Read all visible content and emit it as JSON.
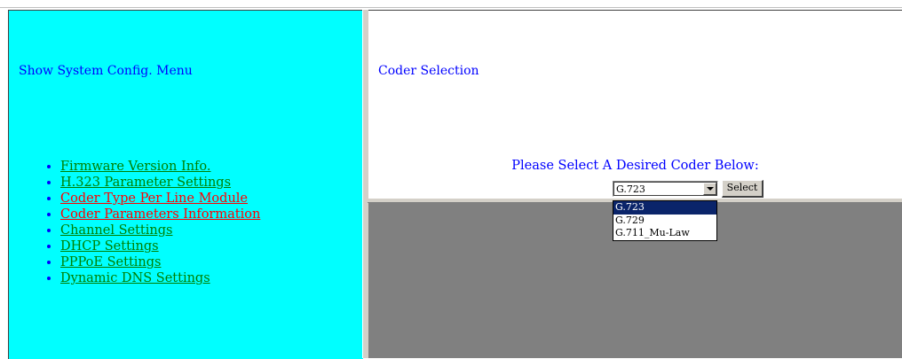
{
  "left_menu": {
    "title": "Show System Config. Menu",
    "items": [
      {
        "label": "Firmware Version Info.",
        "color": "#008000"
      },
      {
        "label": "H.323 Parameter Settings",
        "color": "#008000"
      },
      {
        "label": "Coder Type Per Line Module",
        "color": "#ff0000"
      },
      {
        "label": "Coder Parameters Information",
        "color": "#ff0000"
      },
      {
        "label": "Channel Settings",
        "color": "#008000"
      },
      {
        "label": "DHCP Settings",
        "color": "#008000"
      },
      {
        "label": "PPPoE Settings",
        "color": "#008000"
      },
      {
        "label": "Dynamic DNS Settings",
        "color": "#008000"
      }
    ]
  },
  "main": {
    "title": "Coder Selection",
    "prompt": "Please Select A Desired Coder Below:",
    "coder_select": {
      "value": "G.723",
      "options": [
        "G.723",
        "G.729",
        "G.711_Mu-Law"
      ],
      "highlighted": "G.723"
    },
    "select_button_label": "Select"
  },
  "colors": {
    "menu_background": "#00ffff",
    "text_blue": "#0000ff",
    "link_green": "#008000",
    "link_red": "#ff0000",
    "lower_frame_gray": "#808080",
    "highlight": "#0a246a"
  }
}
